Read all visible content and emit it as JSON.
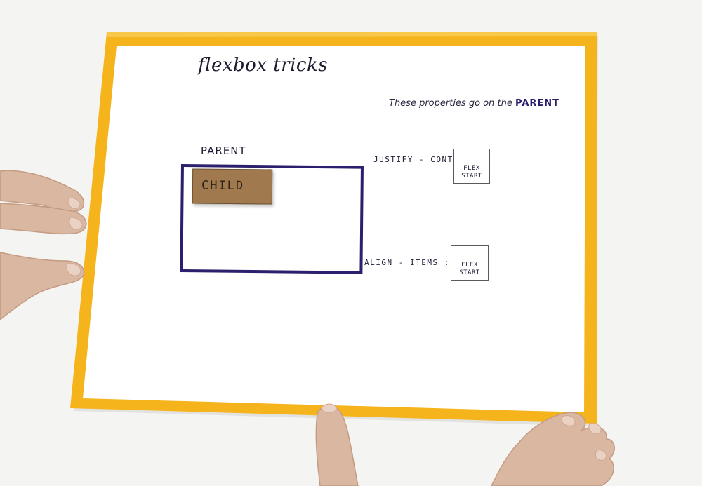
{
  "colors": {
    "background": "#f4f4f2",
    "tape": "#f5b41c",
    "paper": "#ffffff",
    "ink_purple": "#2d1f6e",
    "cardboard": "#a07a4e",
    "skin": "#d9b7a1"
  },
  "sheet": {
    "title": "flexbox tricks",
    "note_prefix": "These properties go on the",
    "note_emphasis": "PARENT"
  },
  "diagram": {
    "parent_label": "PARENT",
    "child_label": "CHILD"
  },
  "properties": [
    {
      "name": "JUSTIFY - CONTENT :",
      "value_line1": "FLEX",
      "value_line2": "START"
    },
    {
      "name": "ALIGN - ITEMS :",
      "value_line1": "FLEX",
      "value_line2": "START"
    }
  ]
}
